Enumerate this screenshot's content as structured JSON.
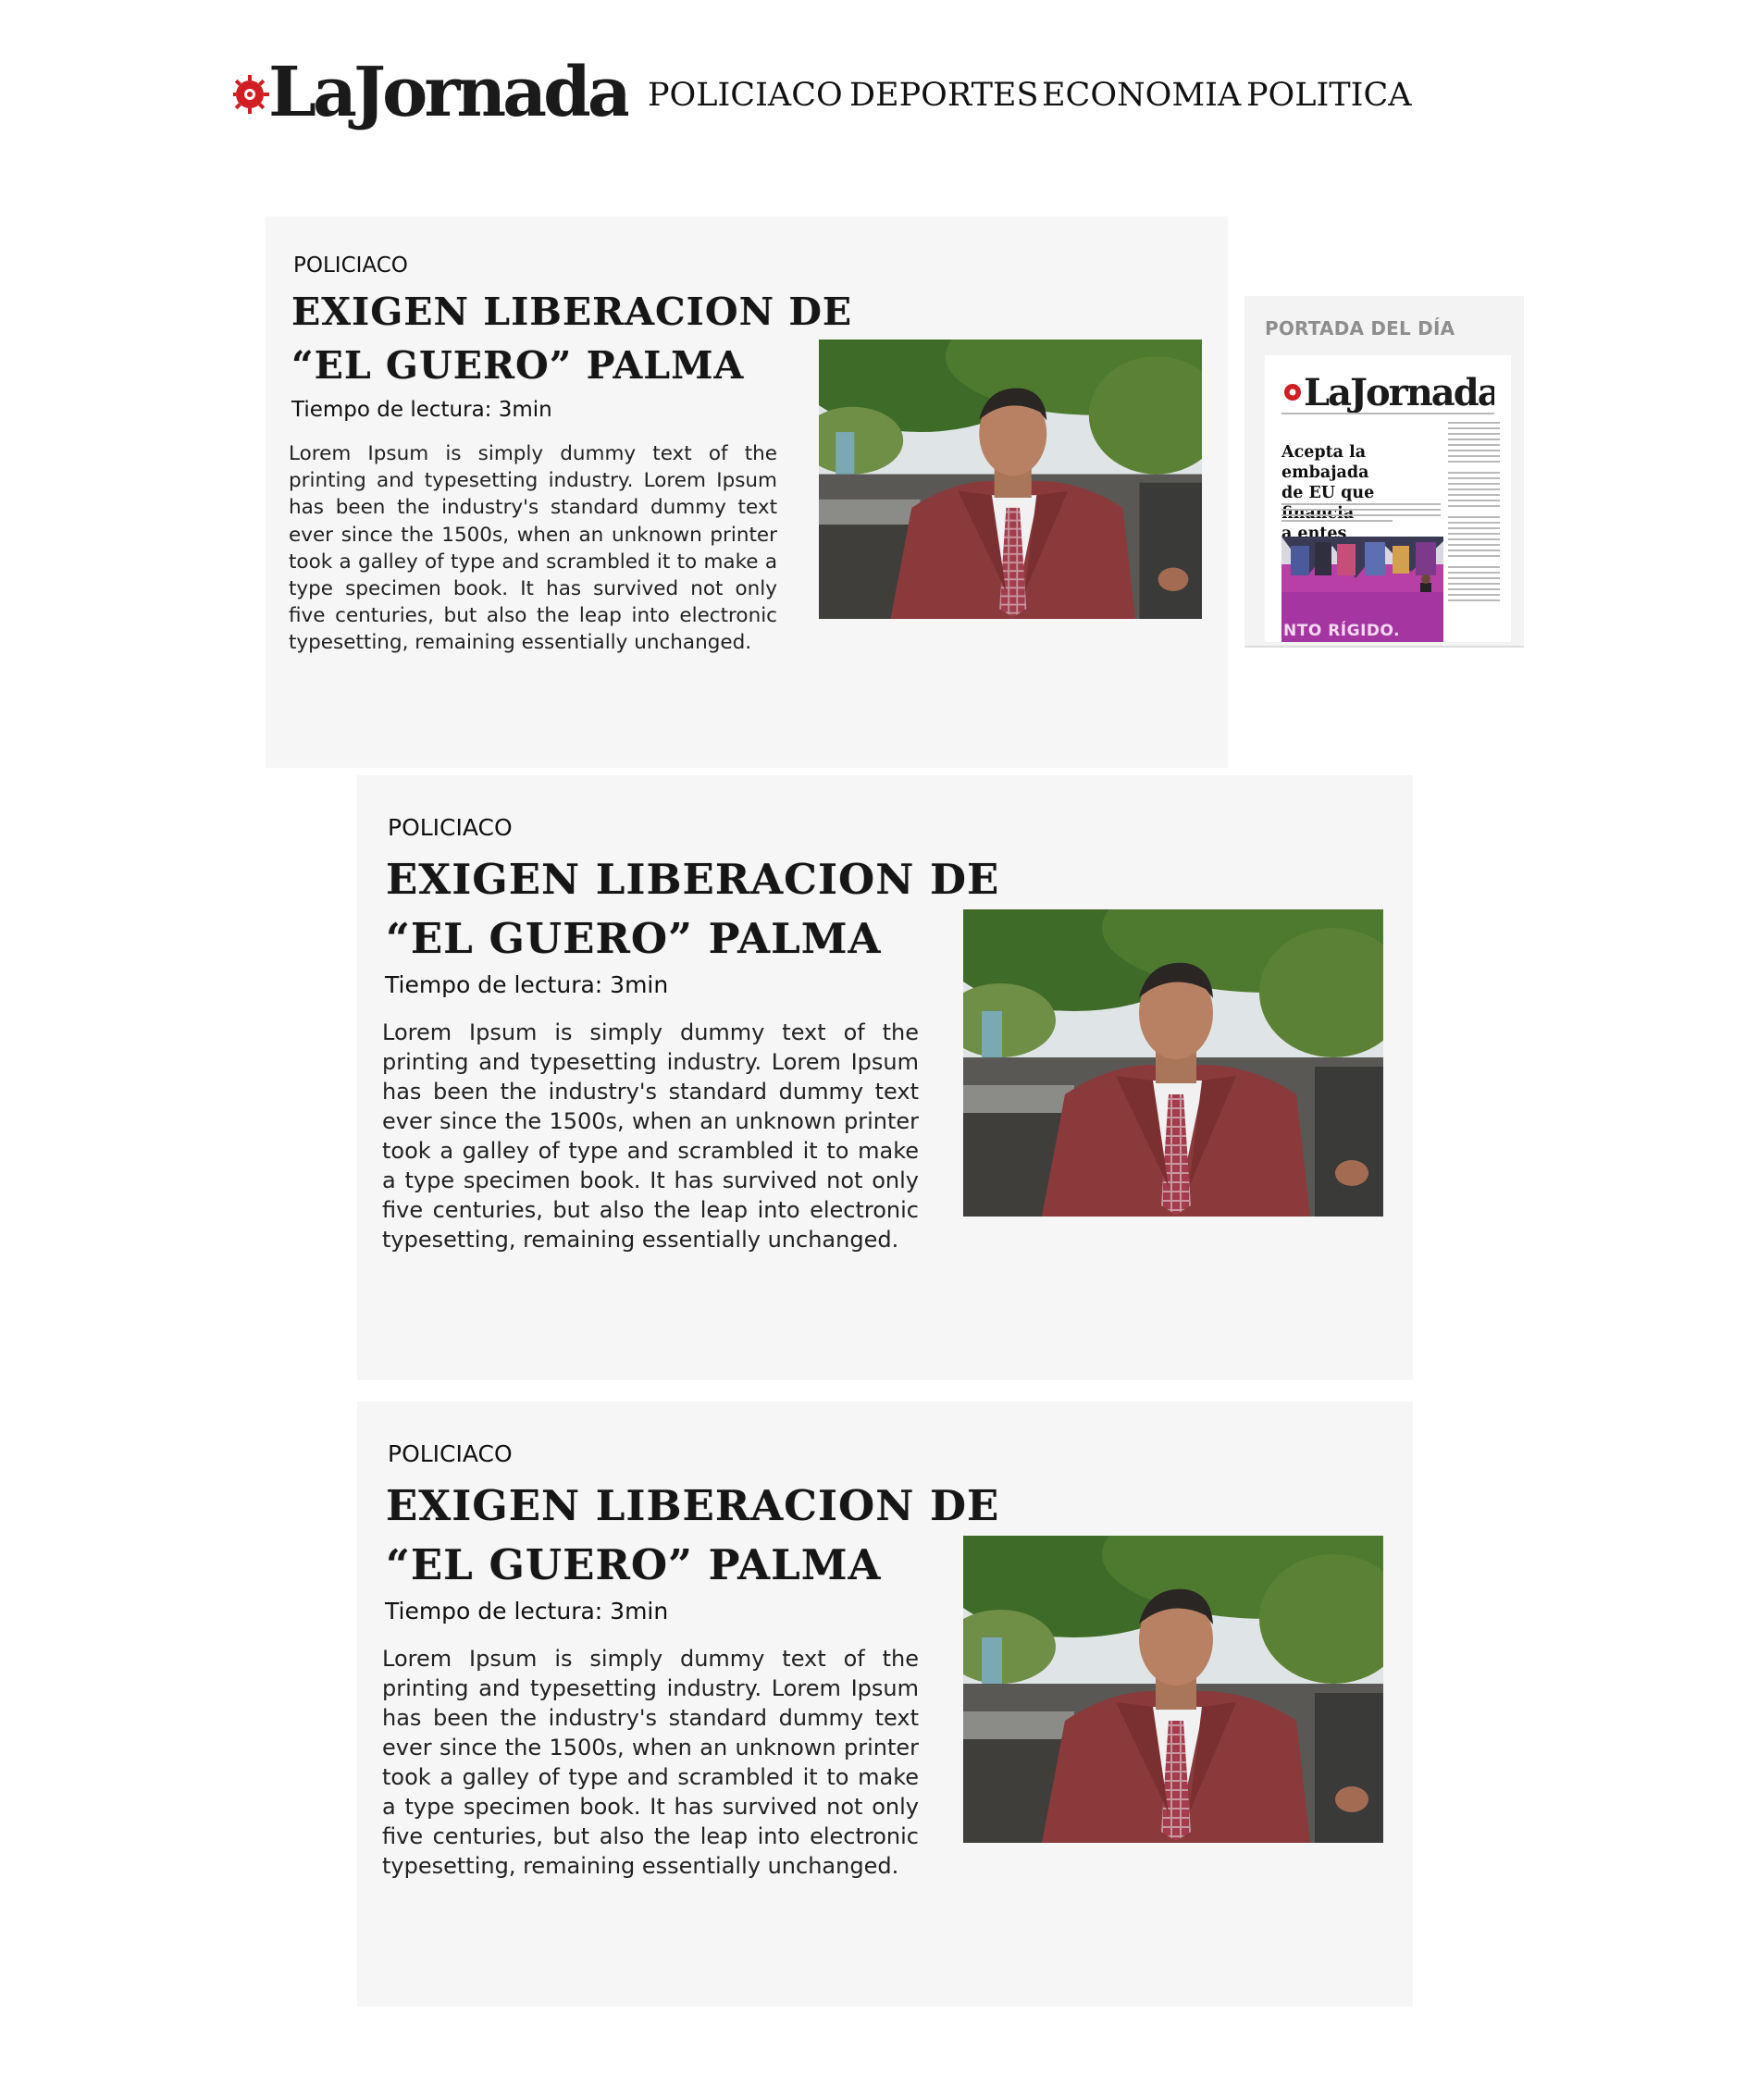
{
  "brand": {
    "name": "LaJornada",
    "colors": {
      "accent": "#d01e23",
      "ink": "#1a1a1a",
      "card_bg": "#f6f6f6",
      "portada_bg": "#f3f3f3"
    }
  },
  "nav": {
    "items": [
      "POLICIACO",
      "DEPORTES",
      "ECONOMIA",
      "POLITICA"
    ]
  },
  "articles": [
    {
      "category": "POLICIACO",
      "title_line1": "EXIGEN LIBERACION DE",
      "title_line2": "“EL GUERO” PALMA",
      "reading_time": "Tiempo de lectura: 3min",
      "body": "Lorem Ipsum is simply dummy text of the printing and typesetting industry. Lorem Ipsum has been the industry's standard dummy text ever since the 1500s, when an unknown printer took a galley of type and scrambled it to make a type specimen book. It has survived not only five centuries, but also the leap into electronic typesetting, remaining essentially unchanged."
    },
    {
      "category": "POLICIACO",
      "title_line1": "EXIGEN LIBERACION DE",
      "title_line2": "“EL GUERO” PALMA",
      "reading_time": "Tiempo de lectura: 3min",
      "body": "Lorem Ipsum is simply dummy text of the printing and typesetting industry. Lorem Ipsum has been the industry's standard dummy text ever since the 1500s, when an unknown printer took a galley of type and scrambled it to make a type specimen book. It has survived not only five centuries, but also the leap into electronic typesetting, remaining essentially unchanged."
    },
    {
      "category": "POLICIACO",
      "title_line1": "EXIGEN LIBERACION DE",
      "title_line2": "“EL GUERO” PALMA",
      "reading_time": "Tiempo de lectura: 3min",
      "body": "Lorem Ipsum is simply dummy text of the printing and typesetting industry. Lorem Ipsum has been the industry's standard dummy text ever since the 1500s, when an unknown printer took a galley of type and scrambled it to make a type specimen book. It has survived not only five centuries, but also the leap into electronic typesetting, remaining essentially unchanged."
    }
  ],
  "portada": {
    "title": "PORTADA DEL DÍA",
    "headline_line1": "Acepta la embajada",
    "headline_line2": "de EU que financia",
    "headline_line3": "a entes opositores",
    "photo_caption": "NTO RÍGIDO."
  }
}
